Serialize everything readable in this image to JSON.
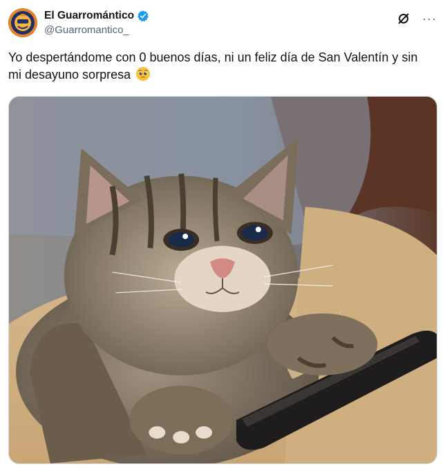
{
  "author": {
    "display_name": "El Guarromántico",
    "handle": "@Guarromantico_",
    "verified": true,
    "avatar_icon": "account-logo-icon",
    "verified_color": "#1d9bf0"
  },
  "header_actions": {
    "grok_icon": "grok-icon",
    "more_icon": "more-options-icon",
    "more_label": "···"
  },
  "tweet": {
    "text": "Yo despertándome con 0 buenos días, ni un feliz día de San Valentín y sin mi desayuno sorpresa",
    "emoji": "pleading-face-emoji"
  },
  "media": {
    "type": "photo",
    "subject": "sad-cat-with-phone-image"
  }
}
